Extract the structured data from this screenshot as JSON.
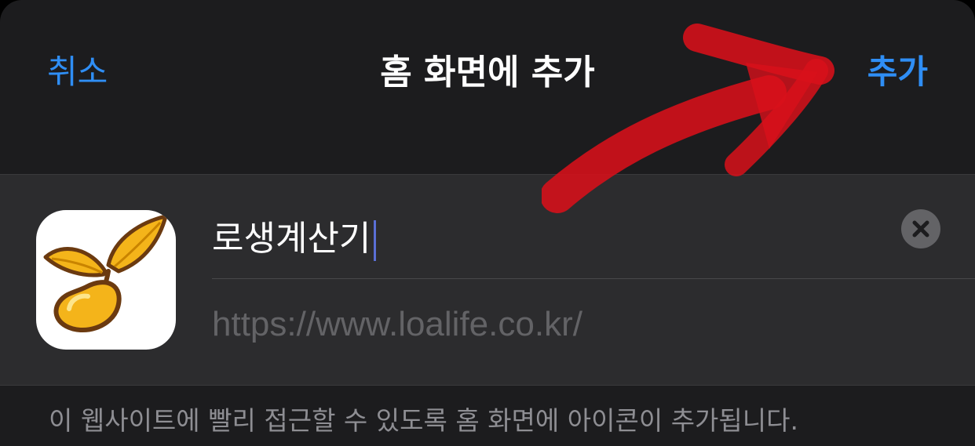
{
  "nav": {
    "cancel_label": "취소",
    "title": "홈 화면에 추가",
    "add_label": "추가"
  },
  "bookmark": {
    "name_value": "로생계산기",
    "url": "https://www.loalife.co.kr/"
  },
  "footer": {
    "note": "이 웹사이트에 빨리 접근할 수 있도록 홈 화면에 아이콘이 추가됩니다."
  },
  "icons": {
    "app_icon": "sprout-app-icon",
    "clear": "clear-icon",
    "annotation": "red-arrow-annotation"
  },
  "colors": {
    "accent": "#2f8ef5",
    "sheet_background": "#1c1c1e",
    "card_background": "#2c2c2e",
    "annotation_red": "#d8101a",
    "icon_gold": "#f4b41a"
  }
}
